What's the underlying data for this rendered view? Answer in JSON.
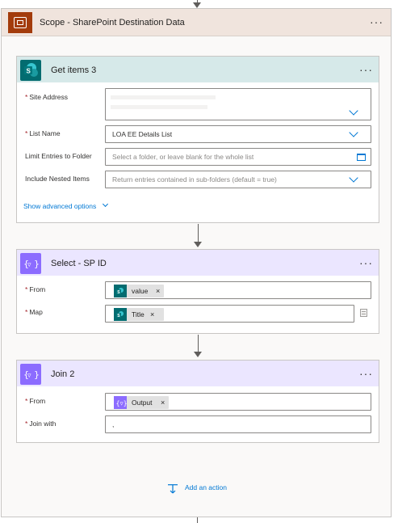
{
  "scope": {
    "title": "Scope - SharePoint Destination Data",
    "more": "···"
  },
  "get_items": {
    "title": "Get items 3",
    "more": "···",
    "fields": {
      "site_address": {
        "label": "Site Address",
        "required": "*"
      },
      "list_name": {
        "label": "List Name",
        "required": "*",
        "value": "LOA EE Details List"
      },
      "limit_folder": {
        "label": "Limit Entries to Folder",
        "placeholder": "Select a folder, or leave blank for the whole list"
      },
      "nested_items": {
        "label": "Include Nested Items",
        "placeholder": "Return entries contained in sub-folders (default = true)"
      }
    },
    "advanced": "Show advanced options"
  },
  "select": {
    "title": "Select - SP ID",
    "more": "···",
    "fields": {
      "from": {
        "label": "From",
        "required": "*",
        "token": "value",
        "remove": "×"
      },
      "map": {
        "label": "Map",
        "required": "*",
        "token": "Title",
        "remove": "×"
      }
    }
  },
  "join": {
    "title": "Join 2",
    "more": "···",
    "fields": {
      "from": {
        "label": "From",
        "required": "*",
        "token": "Output",
        "remove": "×"
      },
      "join_with": {
        "label": "Join with",
        "required": "*",
        "value": ","
      }
    }
  },
  "add_action": {
    "label": "Add an action"
  },
  "colors": {
    "scope_accent": "#a33b0b",
    "scope_header": "#f0e4dd",
    "sharepoint": "#036c70",
    "sharepoint_header": "#d6e9e9",
    "data_ops": "#8c6cff",
    "data_ops_header": "#ebe6ff",
    "link": "#0078d4"
  },
  "icons": {
    "scope": "scope-icon",
    "sharepoint": "sharepoint-icon",
    "data_operation": "data-operation-icon",
    "add_action": "add-action-icon"
  }
}
